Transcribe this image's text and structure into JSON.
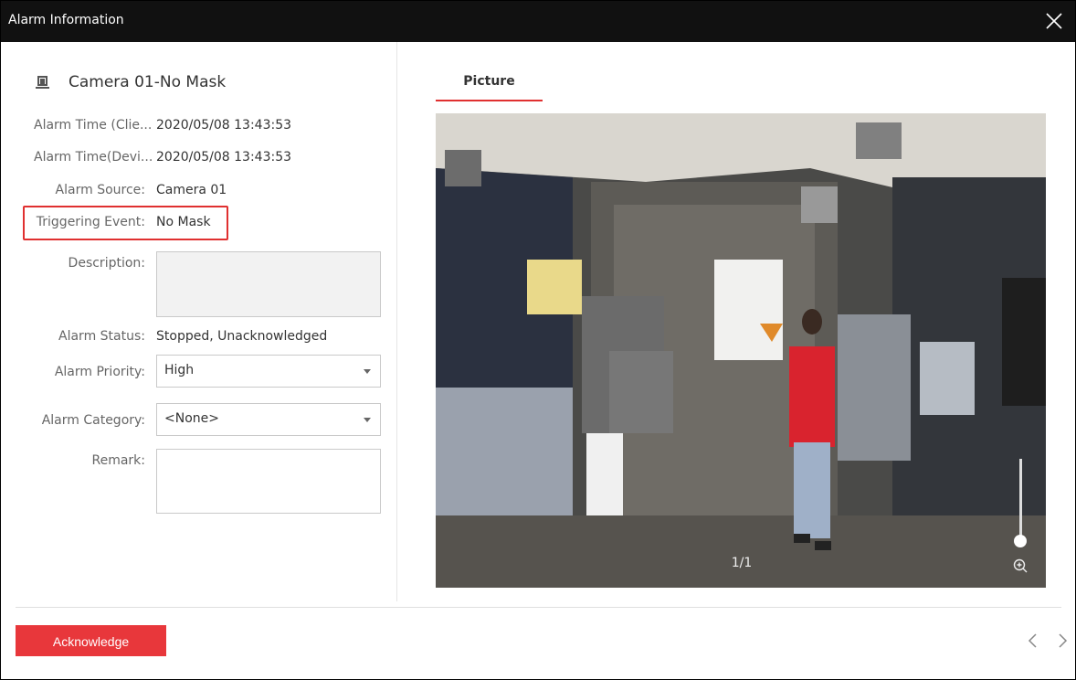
{
  "window": {
    "title": "Alarm Information"
  },
  "alarm": {
    "name": "Camera 01-No Mask",
    "fields": [
      {
        "label": "Alarm Time (Clie...",
        "value": "2020/05/08 13:43:53"
      },
      {
        "label": "Alarm Time(Devi...",
        "value": "2020/05/08 13:43:53"
      },
      {
        "label": "Alarm Source:",
        "value": "Camera 01"
      },
      {
        "label": "Triggering Event:",
        "value": "No Mask"
      }
    ],
    "description_label": "Description:",
    "description_value": "",
    "status_label": "Alarm Status:",
    "status_value": "Stopped, Unacknowledged",
    "priority_label": "Alarm Priority:",
    "priority_value": "High",
    "category_label": "Alarm Category:",
    "category_value": "<None>",
    "remark_label": "Remark:",
    "remark_value": ""
  },
  "viewer": {
    "tab_label": "Picture",
    "counter": "1/1",
    "zoom_level": 0.05
  },
  "footer": {
    "acknowledge_label": "Acknowledge"
  },
  "colors": {
    "accent": "#e8373b",
    "titlebar": "#111111",
    "highlight": "#e03030"
  },
  "icons": {
    "close": "close-icon",
    "camera": "camera-icon",
    "zoom": "zoom-in-icon",
    "prev": "chevron-left-icon",
    "next": "chevron-right-icon"
  }
}
